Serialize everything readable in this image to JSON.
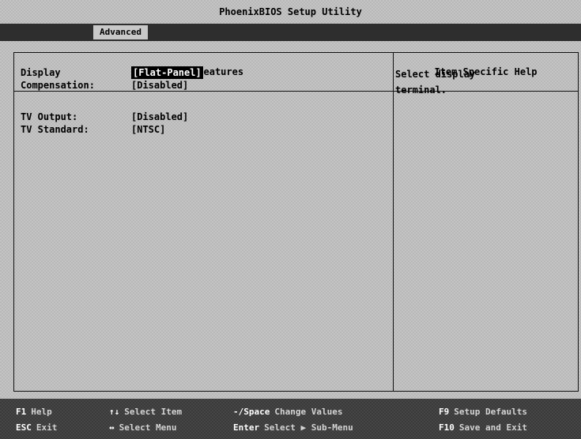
{
  "title": "PhoenixBIOS Setup Utility",
  "menu": {
    "active_tab": "Advanced"
  },
  "panel": {
    "left_header": "Video Features",
    "right_header": "Item Specific Help"
  },
  "settings": [
    {
      "label": "Display",
      "value": "[Flat-Panel]",
      "selected": true
    },
    {
      "label": "Compensation:",
      "value": "[Disabled]",
      "selected": false
    },
    {
      "label": "TV Output:",
      "value": "[Disabled]",
      "selected": false
    },
    {
      "label": "TV Standard:",
      "value": "[NTSC]",
      "selected": false
    }
  ],
  "help": {
    "line1": "Select display",
    "line2": "terminal."
  },
  "footer": {
    "f1_key": "F1",
    "f1_desc": "Help",
    "esc_key": "ESC",
    "esc_desc": "Exit",
    "updown_key": "↑↓",
    "updown_desc": "Select Item",
    "leftright_key": "↔",
    "leftright_desc": "Select Menu",
    "space_key": "-/Space",
    "space_desc": "Change Values",
    "enter_key": "Enter",
    "enter_desc": "Select ▶ Sub-Menu",
    "f9_key": "F9",
    "f9_desc": "Setup Defaults",
    "f10_key": "F10",
    "f10_desc": "Save and Exit"
  },
  "colors": {
    "background": "#c4c4c4",
    "menubar": "#2e2e2e",
    "selected_bg": "#000000",
    "selected_fg": "#ffffff"
  }
}
